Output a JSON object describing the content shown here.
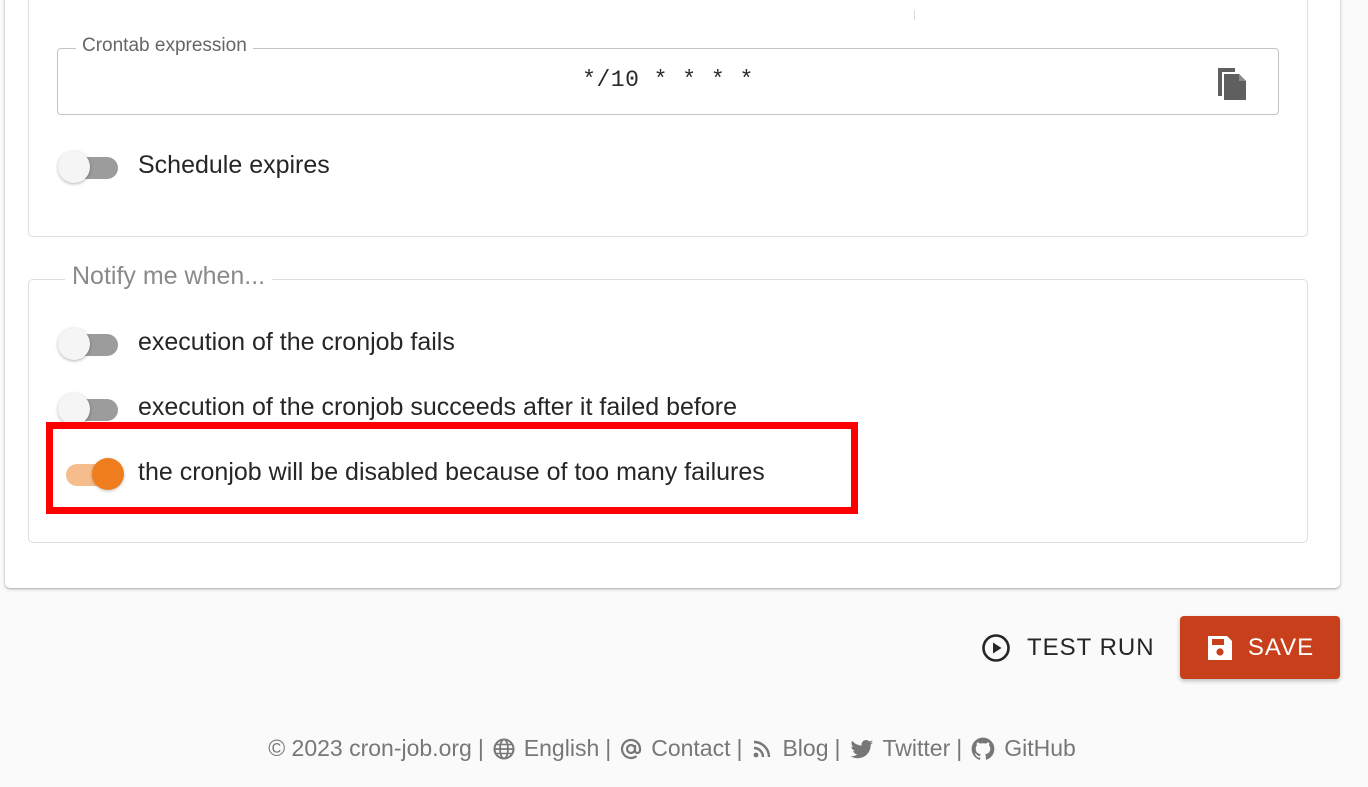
{
  "cron": {
    "legend": "Crontab expression",
    "value": "*/10 * * * *",
    "copy_icon": "content-copy-icon"
  },
  "schedule": {
    "expires_label": "Schedule expires",
    "expires_on": false
  },
  "notify": {
    "legend": "Notify me when...",
    "items": [
      {
        "label": "execution of the cronjob fails",
        "on": false
      },
      {
        "label": "execution of the cronjob succeeds after it failed before",
        "on": false
      },
      {
        "label": "the cronjob will be disabled because of too many failures",
        "on": true
      }
    ]
  },
  "actions": {
    "test_run_label": "TEST RUN",
    "test_run_icon": "play-circle-outline-icon",
    "save_label": "SAVE",
    "save_icon": "floppy-disk-icon"
  },
  "footer": {
    "copyright": "© 2023 cron-job.org",
    "separator": "|",
    "links": [
      {
        "label": "English",
        "icon": "globe-icon"
      },
      {
        "label": "Contact",
        "icon": "at-sign-icon"
      },
      {
        "label": "Blog",
        "icon": "rss-icon"
      },
      {
        "label": "Twitter",
        "icon": "twitter-bird-icon"
      },
      {
        "label": "GitHub",
        "icon": "github-icon"
      }
    ]
  },
  "colors": {
    "accent": "#ef7d1e",
    "accent_track": "#f5bd8b",
    "save_button": "#c8401b",
    "highlight": "#ff0000"
  }
}
